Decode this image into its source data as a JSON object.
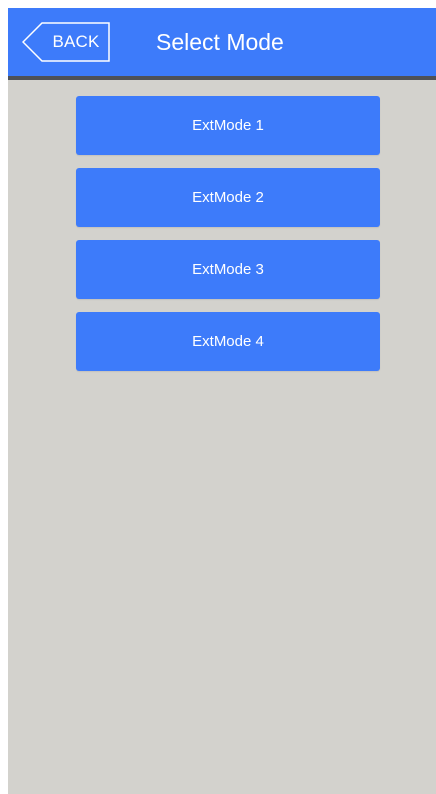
{
  "header": {
    "back_label": "BACK",
    "title": "Select Mode"
  },
  "modes": [
    {
      "label": "ExtMode 1"
    },
    {
      "label": "ExtMode 2"
    },
    {
      "label": "ExtMode 3"
    },
    {
      "label": "ExtMode 4"
    }
  ],
  "colors": {
    "accent": "#3d7bfa",
    "background": "#d3d2cd",
    "header_border": "#4e5157"
  }
}
